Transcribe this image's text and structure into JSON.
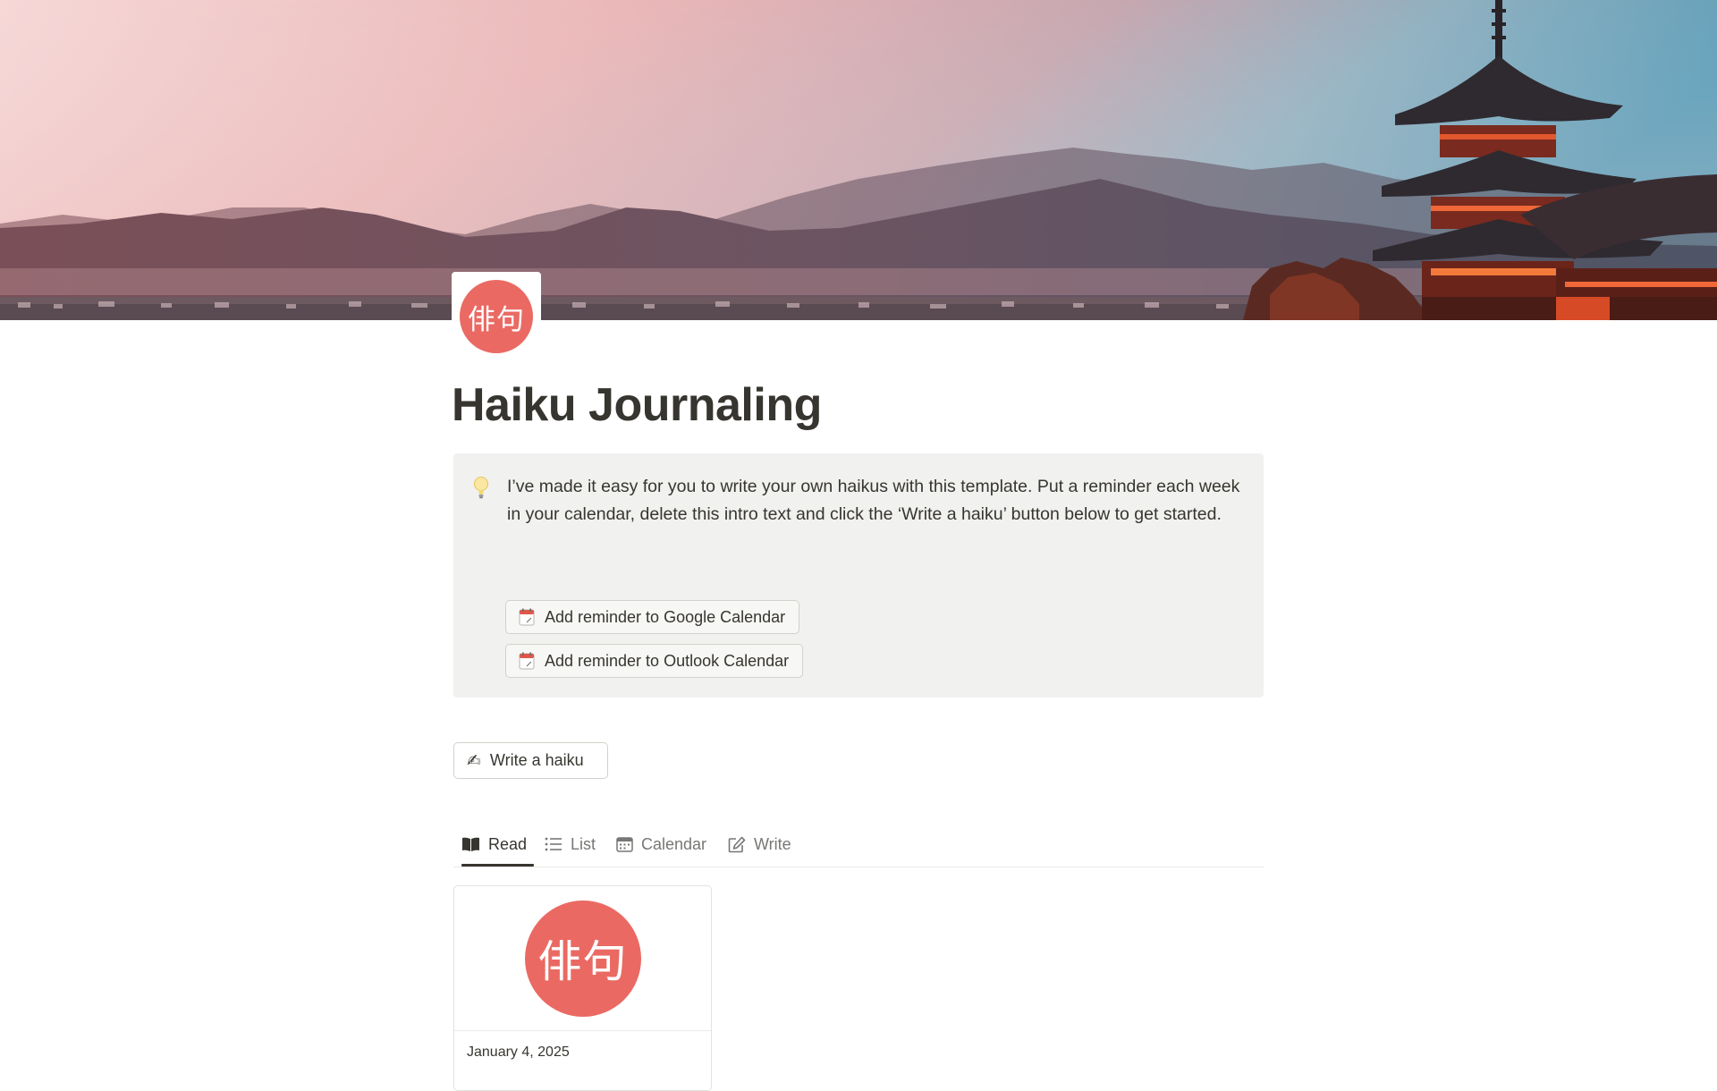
{
  "page": {
    "icon_text": "俳句",
    "icon_color": "#ea6a63",
    "title": "Haiku Journaling"
  },
  "cover": {
    "icon": "pagoda-sunset-landscape"
  },
  "callout": {
    "icon": "lightbulb-icon",
    "text": "I’ve made it easy for you to write your own haikus with this template. Put a reminder each week in your calendar, delete this intro text and click the ‘Write a haiku’ button below to get started.",
    "buttons": [
      {
        "icon": "calendar-icon",
        "label": "Add reminder to Google Calendar"
      },
      {
        "icon": "calendar-icon",
        "label": "Add reminder to Outlook Calendar"
      }
    ]
  },
  "write_button": {
    "icon": "writing-hand-icon",
    "icon_glyph": "✍",
    "label": "Write a haiku"
  },
  "views": {
    "tabs": [
      {
        "icon": "book-open-icon",
        "label": "Read",
        "active": true
      },
      {
        "icon": "list-icon",
        "label": "List",
        "active": false
      },
      {
        "icon": "calendar-icon",
        "label": "Calendar",
        "active": false
      },
      {
        "icon": "edit-icon",
        "label": "Write",
        "active": false
      }
    ]
  },
  "gallery": {
    "cards": [
      {
        "cover_text": "俳句",
        "date": "January 4, 2025"
      }
    ]
  },
  "colors": {
    "text": "#37352f",
    "muted": "#787774",
    "callout_bg": "#f1f1ef",
    "accent_red": "#ea6a63"
  }
}
